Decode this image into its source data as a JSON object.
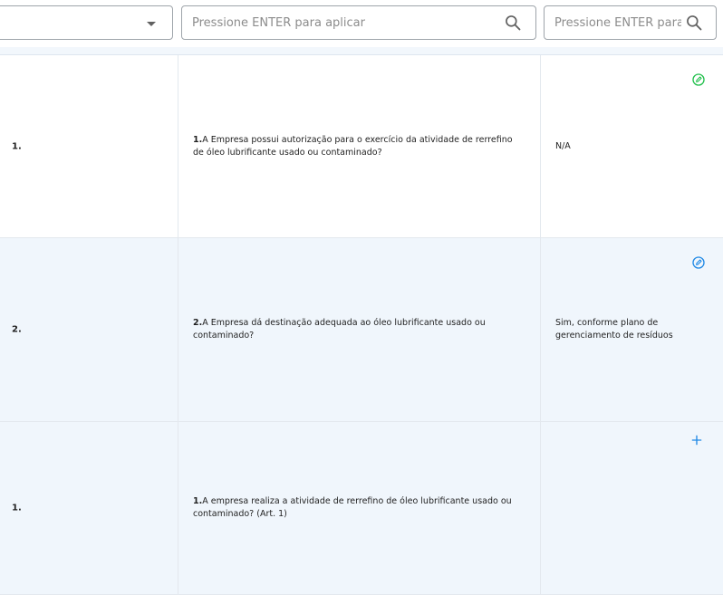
{
  "filters": {
    "select_value": "",
    "search_placeholder_1": "Pressione ENTER para aplicar",
    "search_placeholder_2": "Pressione ENTER para aplicar"
  },
  "rows": [
    {
      "number": "1.",
      "question_number": "1.",
      "question_text": "A Empresa possui autorização para o exercício da atividade de rerrefino de óleo lubrificante usado ou contaminado?",
      "answer": "N/A",
      "action_icon": "edit-check-icon",
      "action_color": "#1fbf4a"
    },
    {
      "number": "2.",
      "question_number": "2.",
      "question_text": "A Empresa dá destinação adequada ao óleo lubrificante usado ou contaminado?",
      "answer": "Sim, conforme plano de gerenciamento de resíduos",
      "action_icon": "edit-check-icon",
      "action_color": "#1e88e5"
    },
    {
      "number": "1.",
      "question_number": "1.",
      "question_text": "A empresa realiza a atividade de rerrefino de óleo lubrificante usado ou contaminado? (Art. 1)",
      "answer": "",
      "action_icon": "plus-icon",
      "action_color": "#1e88e5"
    }
  ]
}
